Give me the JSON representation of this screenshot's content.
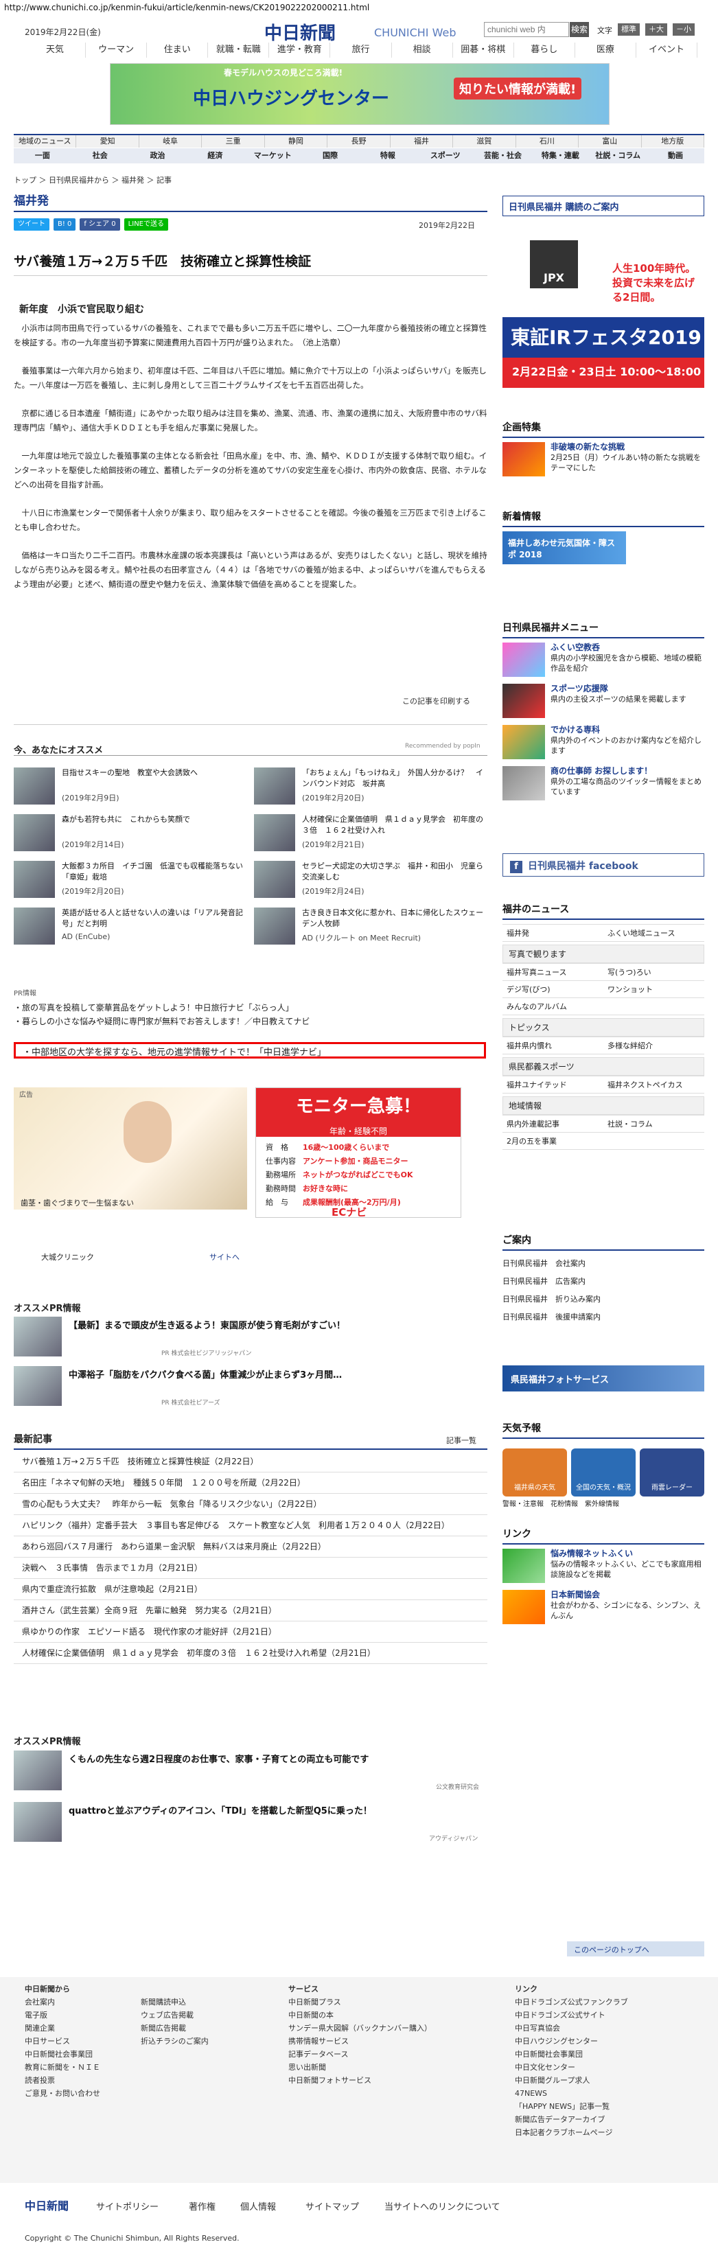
{
  "url": "http://www.chunichi.co.jp/kenmin-fukui/article/kenmin-news/CK2019022202000211.html",
  "header": {
    "date": "2019年2月22日(金)",
    "logo": "中日新聞",
    "logo_sub": "CHUNICHI Web",
    "search_placeholder": "chunichi web 内",
    "search_btn": "検索",
    "font_label": "文字",
    "font_items": [
      "標準",
      "＋大",
      "－小"
    ]
  },
  "nav1": [
    "天気",
    "ウーマン",
    "住まい",
    "就職・転職",
    "進学・教育",
    "旅行",
    "相談",
    "囲碁・将棋",
    "暮らし",
    "医療",
    "イベント"
  ],
  "banner": {
    "top": "春モデルハウスの見どころ満載!",
    "main": "中日ハウジングセンター",
    "tag": "知りたい情報が満載!"
  },
  "nav2": [
    "地域のニュース",
    "愛知",
    "岐阜",
    "三重",
    "静岡",
    "長野",
    "福井",
    "滋賀",
    "石川",
    "富山",
    "地方版"
  ],
  "nav3": [
    "一面",
    "社会",
    "政治",
    "経済",
    "マーケット",
    "国際",
    "特報",
    "スポーツ",
    "芸能・社会",
    "特集・連載",
    "社説・コラム",
    "動画"
  ],
  "crumb": "トップ ＞ 日刊県民福井から ＞ 福井発 ＞ 記事",
  "section_title": "福井発",
  "share": [
    "ツイート",
    "B! 0",
    "f シェア 0",
    "LINEで送る"
  ],
  "article": {
    "date": "2019年2月22日",
    "title": "サバ養殖１万→２万５千匹　技術確立と採算性検証",
    "subtitle": "新年度　小浜で官民取り組む",
    "paras": [
      "小浜市は同市田鳥で行っているサバの養殖を、これまでで最も多い二万五千匹に増やし、二〇一九年度から養殖技術の確立と採算性を検証する。市の一九年度当初予算案に関連費用九百四十万円が盛り込まれた。　（池上浩章）",
      "養殖事業は一六年六月から始まり、初年度は千匹、二年目は八千匹に増加。鯖に魚介で十万以上の「小浜よっぱらいサバ」を販売した。一八年度は一万匹を養殖し、主に刺し身用として三百二十グラムサイズを七千五百匹出荷した。",
      "京都に通じる日本遺産「鯖街道」にあやかった取り組みは注目を集め、漁業、流通、市、漁業の連携に加え、大阪府豊中市のサバ料理専門店「鯖や」、通信大手ＫＤＤＩとも手を組んだ事業に発展した。",
      "一九年度は地元で設立した養殖事業の主体となる新会社「田鳥水産」を中、市、漁、鯖や、ＫＤＤＩが支援する体制で取り組む。インターネットを駆使した給餌技術の確立、蓄積したデータの分析を進めてサバの安定生産を心掛け、市内外の飲食店、民宿、ホテルなどへの出荷を目指す計画。",
      "十八日に市漁業センターで関係者十人余りが集まり、取り組みをスタートさせることを確認。今後の養殖を三万匹まで引き上げることも申し合わせた。",
      "価格は一キロ当たり二千二百円。市農林水産課の坂本亮課長は「高いという声はあるが、安売りはしたくない」と話し、現状を維持しながら売り込みを図る考え。鯖や社長の右田孝宣さん（４４）は「各地でサバの養殖が始まる中、よっぱらいサバを進んでもらえるよう理由が必要」と述べ、鯖街道の歴史や魅力を伝え、漁業体験で価値を高めることを提案した。"
    ],
    "print": "この記事を印刷する"
  },
  "recommend": {
    "heading": "今、あなたにオススメ",
    "by": "Recommended by popIn",
    "items": [
      {
        "t": "目指せスキーの聖地　教室や大会誘致へ",
        "d": "(2019年2月9日)"
      },
      {
        "t": "「おちょぇん」「もっけねえ」　外国人分かるけ？　インバウンド対応　坂井高",
        "d": "(2019年2月20日)"
      },
      {
        "t": "森がも若狩も共に　これからも笑顔で",
        "d": "(2019年2月14日)"
      },
      {
        "t": "人材確保に企業価値明　県１ｄａｙ見学会　初年度の３倍　１６２社受け入れ",
        "d": "(2019年2月21日)"
      },
      {
        "t": "大飯都３カ所目　イチゴ園　低温でも収穫能落ちない「章姫」栽培",
        "d": "(2019年2月20日)"
      },
      {
        "t": "セラピー犬認定の大切さ学ぶ　福井・和田小　児童ら交流楽しむ",
        "d": "(2019年2月24日)"
      },
      {
        "t": "英語が話せる人と話せない人の違いは「リアル発音記号」だと判明",
        "d": "AD (EnCube)"
      },
      {
        "t": "古き良き日本文化に惹かれ、日本に帰化したスウェーデン人牧師",
        "d": "AD (リクルート on Meet Recruit)"
      }
    ]
  },
  "pr": {
    "label": "PR情報",
    "items": [
      "旅の写真を投稿して豪華賞品をゲットしよう！中日旅行ナビ「ぶらっ人」",
      "暮らしの小さな悩みや疑問に専門家が無料でお答えします！／中日教えてナビ"
    ],
    "highlight": "中部地区の大学を探すなら、地元の進学情報サイトで！「中日進学ナビ」"
  },
  "ads": {
    "label": "広告",
    "left_caption": "歯茎・歯ぐづまりで一生悩まない",
    "clinic": "大城クリニック",
    "site": "サイトへ",
    "right": {
      "head": "モニター急募！",
      "sub": "年齢・経験不問",
      "rows": [
        [
          "資　格",
          "16歳～100歳くらいまで"
        ],
        [
          "仕事内容",
          "アンケート参加・商品モニター"
        ],
        [
          "勤務場所",
          "ネットがつながればどこでもOK"
        ],
        [
          "勤務時間",
          "お好きな時に"
        ],
        [
          "給　与",
          "成果報酬制(最高～2万円/月)"
        ]
      ],
      "brand": "ECナビ"
    }
  },
  "osusume": {
    "heading": "オススメPR情報",
    "items": [
      {
        "t": "【最新】まるで頭皮が生き返るよう！東国原が使う育毛剤がすごい！",
        "pr": "PR 株式会社ビジアリッジャパン"
      },
      {
        "t": "中澤裕子「脂肪をパクパク食べる菌」体重減少が止まらず3ヶ月間…",
        "pr": "PR 株式会社ピアーズ"
      }
    ]
  },
  "news": {
    "heading": "最新記事",
    "all": "記事一覧",
    "items": [
      "サバ養殖１万→２万５千匹　技術確立と採算性検証（2月22日）",
      "名田庄「ネネマ旬鮮の天地」　種銭５０年間　１２００号を所蔵（2月22日）",
      "雪の心配もう大丈夫？　昨年から一転　気象台「降るリスク少ない」（2月22日）",
      "ハピリンク（福井）定番手芸大　３事目も客足伸びる　スケート教室など人気　利用者１万２０４０人（2月22日）",
      "あわら巡回バス７月運行　あわら道果－金沢駅　無料バスは来月廃止（2月22日）",
      "決戦へ　３氏事情　告示まで１カ月（2月21日）",
      "県内で重症流行拡散　県が注意喚起（2月21日）",
      "酒井さん（武生芸業）全商９冠　先輩に触発　努力実る（2月21日）",
      "県ゆかりの作家　エピソード語る　現代作家の才能好評（2月21日）",
      "人材確保に企業価値明　県１ｄａｙ見学会　初年度の３倍　１６２社受け入れ希望（2月21日）"
    ]
  },
  "osusume2": {
    "heading": "オススメPR情報",
    "items": [
      {
        "t": "くもんの先生なら週2日程度のお仕事で、家事・子育てとの両立も可能です",
        "pr": "公文教育研究会"
      },
      {
        "t": "quattroと並ぶアウディのアイコン、「TDI」を搭載した新型Q5に乗った！",
        "pr": "アウディジャパン"
      }
    ]
  },
  "side": {
    "pr_title": "日刊県民福井 購読のご案内",
    "ad": {
      "jpx": "JPX",
      "top": "人生100年時代。投資で未来を広げる2日間。",
      "main": "東証IRフェスタ2019",
      "date": "2月22日金・23日土 10:00～18:00"
    },
    "kikaku": "企画特集",
    "kikaku_item": {
      "b": "非破壊の新たな挑戦",
      "t": "2月25日（月）ウイルあい特の新たな挑戦をテーマにした"
    },
    "shincyaku": "新着情報",
    "shincyaku_item": "福井しあわせ元気国体・障スポ 2018",
    "menu": "日刊県民福井メニュー",
    "menu_items": [
      {
        "b": "ふくい空教呑",
        "t": "県内の小学校園児を含から模範、地域の模範作品を紹介"
      },
      {
        "b": "スポーツ応援隊",
        "t": "県内の主役スポーツの結果を掲載します"
      },
      {
        "b": "でかける専科",
        "t": "県内外のイベントのおかけ案内などを紹介します"
      },
      {
        "b": "商の仕事師 お探しします！",
        "t": "県外の工場な商品のツイッター情報をまとめています"
      }
    ],
    "facebook": "日刊県民福井 facebook",
    "fnews": "福井のニュース",
    "fnews_items": [
      "福井発",
      "ふくい地域ニュース"
    ],
    "photo_h": "写真で観ります",
    "photo_items": [
      "福井写真ニュース",
      "写(うつ)ろい",
      "デジ写(びつ)",
      "ワンショット"
    ],
    "album": "みんなのアルバム",
    "topics": "トピックス",
    "topics_items": [
      "福井県内慣れ",
      "多様な絆紹介"
    ],
    "sports": "県民都義スポーツ",
    "sports_items": [
      "福井ユナイテッド",
      "福井ネクストペイカス"
    ],
    "chiiki": "地域情報",
    "chiiki_items": [
      "県内外連載記事",
      "社説・コラム"
    ],
    "chiiki2": "2月の五を事業",
    "annai": "ご案内",
    "annai_items": [
      "日刊県民福井　会社案内",
      "日刊県民福井　広告案内",
      "日刊県民福井　折り込み案内",
      "日刊県民福井　後援申請案内"
    ],
    "photo_service": "県民福井フォトサービス",
    "tenki": "天気予報",
    "tenki_items": [
      "福井県の天気",
      "全国の天気・概況",
      "雨雲レーダー"
    ],
    "tenki_links": [
      "警報・注意報",
      "花粉情報",
      "紫外線情報"
    ],
    "link": "リンク",
    "link_items": [
      {
        "b": "悩み情報ネットふくい",
        "t": "悩みの情報ネットふくい、どこでも家庭用相談施設などを掲載"
      },
      {
        "b": "日本新聞協会",
        "t": "社会がわかる、シゴンになる、シンブン、えんぶん"
      }
    ],
    "totop": "このページのトップへ"
  },
  "footer": {
    "cols": [
      {
        "h": "中日新聞から",
        "items": [
          "会社案内",
          "電子版",
          "関連企業",
          "中日サービス",
          "中日新聞社会事業団",
          "教育に新聞を・ＮＩＥ",
          "読者投票",
          "ご意見・お問い合わせ"
        ]
      },
      {
        "h": "",
        "items": [
          "新聞購読申込",
          "ウェブ広告掲載",
          "新聞広告掲載",
          "折込チラシのご案内"
        ]
      },
      {
        "h": "サービス",
        "items": [
          "中日新聞プラス",
          "中日新聞の本",
          "サンデー県大図解（バックナンバー購入）",
          "携帯情報サービス",
          "記事データベース",
          "思い出新聞",
          "中日新聞フォトサービス"
        ]
      },
      {
        "h": "リンク",
        "items": [
          "中日ドラゴンズ公式ファンクラブ",
          "中日ドラゴンズ公式サイト",
          "中日写真協会",
          "中日ハウジングセンター",
          "中日新聞社会事業団",
          "中日文化センター",
          "中日新聞グループ求人",
          "47NEWS",
          "「HAPPY NEWS」記事一覧",
          "新聞広告データアーカイブ",
          "日本記者クラブホームページ"
        ]
      }
    ],
    "bar": {
      "logo": "中日新聞",
      "links": [
        "サイトポリシー",
        "著作権",
        "個人情報",
        "サイトマップ",
        "当サイトへのリンクについて"
      ]
    },
    "copy": "Copyright © The Chunichi Shimbun, All Rights Reserved."
  }
}
